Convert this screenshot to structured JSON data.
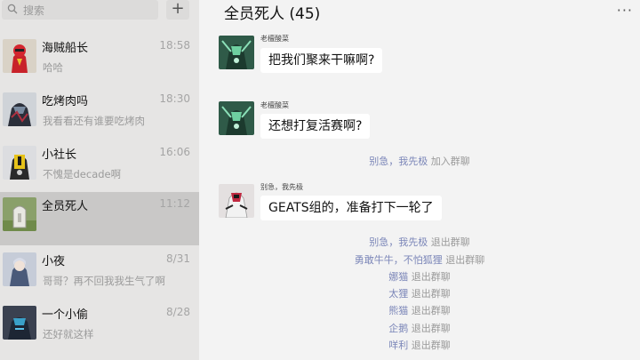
{
  "sidebar": {
    "search_placeholder": "搜索",
    "add_label": "+",
    "chats": [
      {
        "name": "海贼船长",
        "time": "18:58",
        "preview": "哈哈"
      },
      {
        "name": "吃烤肉吗",
        "time": "18:30",
        "preview": "我看看还有谁要吃烤肉"
      },
      {
        "name": "小社长",
        "time": "16:06",
        "preview": "不愧是decade啊"
      },
      {
        "name": "全员死人",
        "time": "11:12",
        "preview": ""
      },
      {
        "name": "小夜",
        "time": "8/31",
        "preview": "哥哥？再不回我我生气了啊"
      },
      {
        "name": "一个小偷",
        "time": "8/28",
        "preview": "还好就这样"
      }
    ]
  },
  "chat": {
    "title": "全员死人 (45)",
    "more_label": "···",
    "messages": [
      {
        "sender": "老檀酸菜",
        "text": "把我们聚来干嘛啊?"
      },
      {
        "sender": "老檀酸菜",
        "text": "还想打复活赛啊?"
      },
      {
        "sender": "别急，我先极",
        "text": "GEATS组的，准备打下一轮了"
      }
    ],
    "system": [
      {
        "name": "别急，我先极",
        "action": "加入群聊"
      },
      {
        "name": "别急，我先极",
        "action": "退出群聊"
      },
      {
        "name": "勇敢牛牛，不怕狐狸",
        "action": "退出群聊"
      },
      {
        "name": "娜猫",
        "action": "退出群聊"
      },
      {
        "name": "太狸",
        "action": "退出群聊"
      },
      {
        "name": "熊猫",
        "action": "退出群聊"
      },
      {
        "name": "企鹅",
        "action": "退出群聊"
      },
      {
        "name": "咩利",
        "action": "退出群聊"
      }
    ]
  }
}
